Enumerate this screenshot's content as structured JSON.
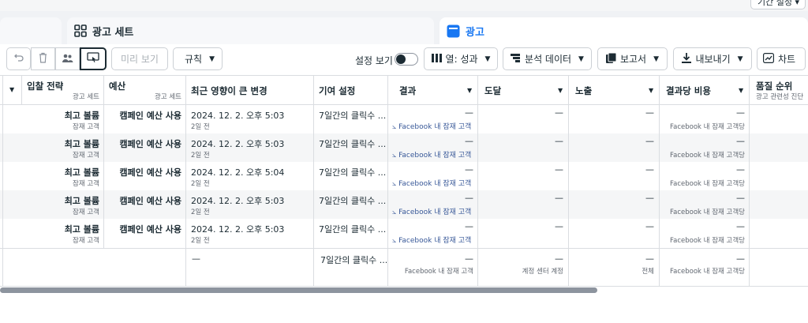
{
  "top": {
    "dropdown_label": "기간 설정"
  },
  "tabs": {
    "sets_label": "광고 세트",
    "ads_label": "광고"
  },
  "toolbar": {
    "preview_label": "미리 보기",
    "rules_label": "규칙",
    "view_settings_label": "설정 보기",
    "columns_label": "열: 성과",
    "breakdown_label": "분석 데이터",
    "reports_label": "보고서",
    "export_label": "내보내기",
    "chart_label": "차트"
  },
  "columns": {
    "bid_strategy": "입찰 전략",
    "bid_strategy_sub": "광고 세트",
    "budget": "예산",
    "budget_sub": "광고 세트",
    "last_change": "최근 영향이 큰 변경",
    "attribution": "기여 설정",
    "results": "결과",
    "reach": "도달",
    "impressions": "노출",
    "cost_per_result": "결과당 비용",
    "quality": "품질 순위",
    "quality_sub": "광고 관련성 진단"
  },
  "rows": [
    {
      "bid": "최고 볼륨",
      "bid_sub": "잠재 고객",
      "budget": "캠페인 예산 사용",
      "changed": "2024. 12. 2. 오후 5:03",
      "changed_ago": "2일 전",
      "attribution": "7일간의 클릭수 ...",
      "result": "—",
      "result_link": "Facebook 내 잠재 고객",
      "reach": "—",
      "impressions": "—",
      "cost": "—",
      "cost_sub": "Facebook 내 잠재 고객당"
    },
    {
      "bid": "최고 볼륨",
      "bid_sub": "잠재 고객",
      "budget": "캠페인 예산 사용",
      "changed": "2024. 12. 2. 오후 5:03",
      "changed_ago": "2일 전",
      "attribution": "7일간의 클릭수 ...",
      "result": "—",
      "result_link": "Facebook 내 잠재 고객",
      "reach": "—",
      "impressions": "—",
      "cost": "—",
      "cost_sub": "Facebook 내 잠재 고객당"
    },
    {
      "bid": "최고 볼륨",
      "bid_sub": "잠재 고객",
      "budget": "캠페인 예산 사용",
      "changed": "2024. 12. 2. 오후 5:04",
      "changed_ago": "2일 전",
      "attribution": "7일간의 클릭수 ...",
      "result": "—",
      "result_link": "Facebook 내 잠재 고객",
      "reach": "—",
      "impressions": "—",
      "cost": "—",
      "cost_sub": "Facebook 내 잠재 고객당"
    },
    {
      "bid": "최고 볼륨",
      "bid_sub": "잠재 고객",
      "budget": "캠페인 예산 사용",
      "changed": "2024. 12. 2. 오후 5:03",
      "changed_ago": "2일 전",
      "attribution": "7일간의 클릭수 ...",
      "result": "—",
      "result_link": "Facebook 내 잠재 고객",
      "reach": "—",
      "impressions": "—",
      "cost": "—",
      "cost_sub": "Facebook 내 잠재 고객당"
    },
    {
      "bid": "최고 볼륨",
      "bid_sub": "잠재 고객",
      "budget": "캠페인 예산 사용",
      "changed": "2024. 12. 2. 오후 5:03",
      "changed_ago": "2일 전",
      "attribution": "7일간의 클릭수 ...",
      "result": "—",
      "result_link": "Facebook 내 잠재 고객",
      "reach": "—",
      "impressions": "—",
      "cost": "—",
      "cost_sub": "Facebook 내 잠재 고객당"
    }
  ],
  "summary": {
    "changed": "—",
    "attribution": "7일간의 클릭수 ...",
    "result": "—",
    "result_sub": "Facebook 내 잠재 고객",
    "reach": "—",
    "reach_sub": "계정 센터 계정",
    "impressions": "—",
    "impressions_sub": "전체",
    "cost": "—",
    "cost_sub": "Facebook 내 잠재 고객당"
  },
  "colors": {
    "accent": "#1877f2",
    "link": "#385898",
    "border": "#dadde1"
  }
}
